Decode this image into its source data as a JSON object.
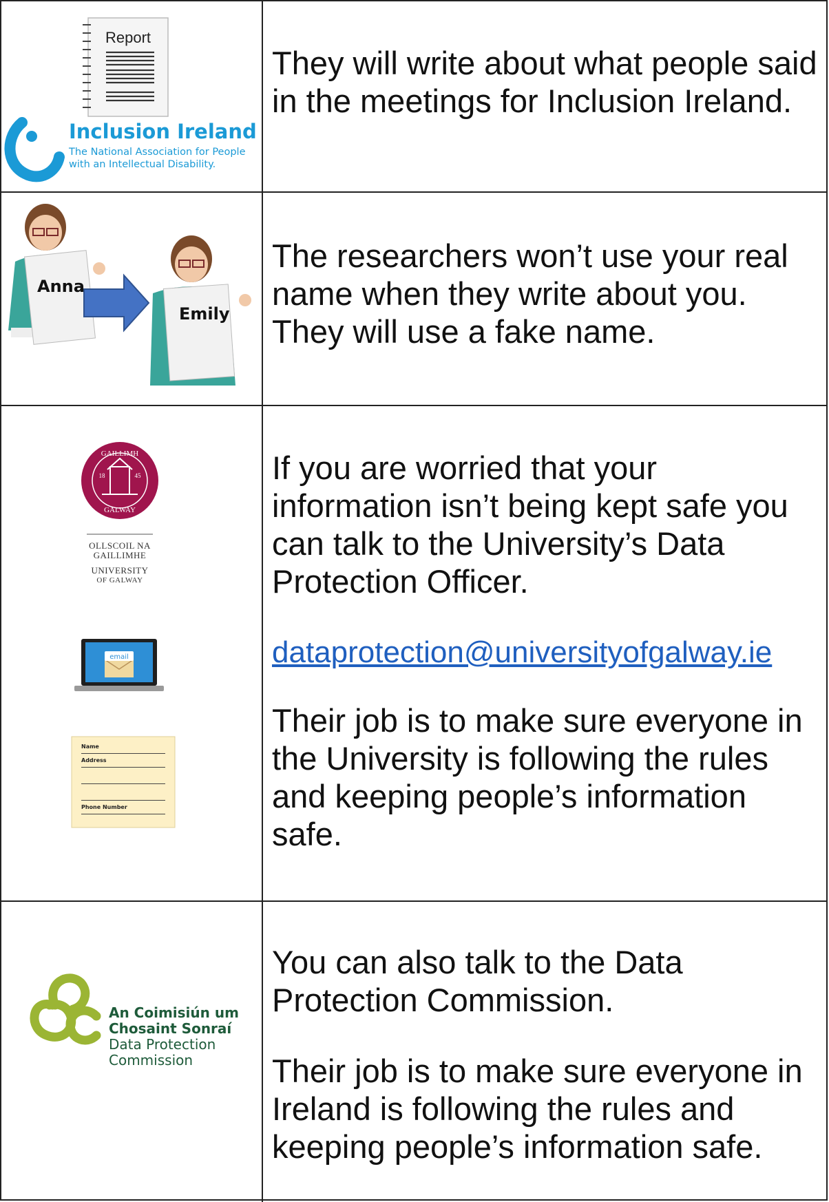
{
  "rows": [
    {
      "text": "They will write about what people said in the meetings for Inclusion Ireland.",
      "images": {
        "report_label": "Report",
        "org_name": "Inclusion Ireland",
        "org_sub_1": "The National Association for People",
        "org_sub_2": "with an Intellectual Disability."
      }
    },
    {
      "text": "The researchers won’t use your real name when they write about you. They will use a fake name.",
      "images": {
        "name_before": "Anna",
        "name_after": "Emily"
      }
    },
    {
      "text": "If you are worried that your information isn’t being kept safe you can talk to the University’s Data Protection Officer.",
      "email": "dataprotection@universityofgalway.ie",
      "text2": "Their job is to make sure everyone in the University is following the rules and keeping people’s information safe.",
      "images": {
        "seal_top": "GAILLIMH",
        "seal_bottom": "GALWAY",
        "seal_year_left": "18",
        "seal_year_right": "45",
        "uni_line1": "OLLSCOIL NA",
        "uni_line2": "GAILLIMHE",
        "uni_line3": "UNIVERSITY",
        "uni_line4": "OF GALWAY",
        "email_label": "email",
        "form_name": "Name",
        "form_address": "Address",
        "form_phone": "Phone Number"
      }
    },
    {
      "text": "You can also talk to the Data Protection Commission.",
      "text2": "Their job is to make sure everyone in Ireland is following the rules and keeping people’s information safe.",
      "images": {
        "dpc_ga_1": "An Coimisiún um",
        "dpc_ga_2": "Chosaint Sonraí",
        "dpc_en_1": "Data Protection",
        "dpc_en_2": "Commission"
      }
    }
  ],
  "colors": {
    "border": "#222222",
    "link": "#1f5fbf",
    "inclusion_blue": "#1b9ad6",
    "galway_red": "#a0154d",
    "dpc_green": "#9bb534",
    "dpc_dark": "#1e5b3a"
  }
}
